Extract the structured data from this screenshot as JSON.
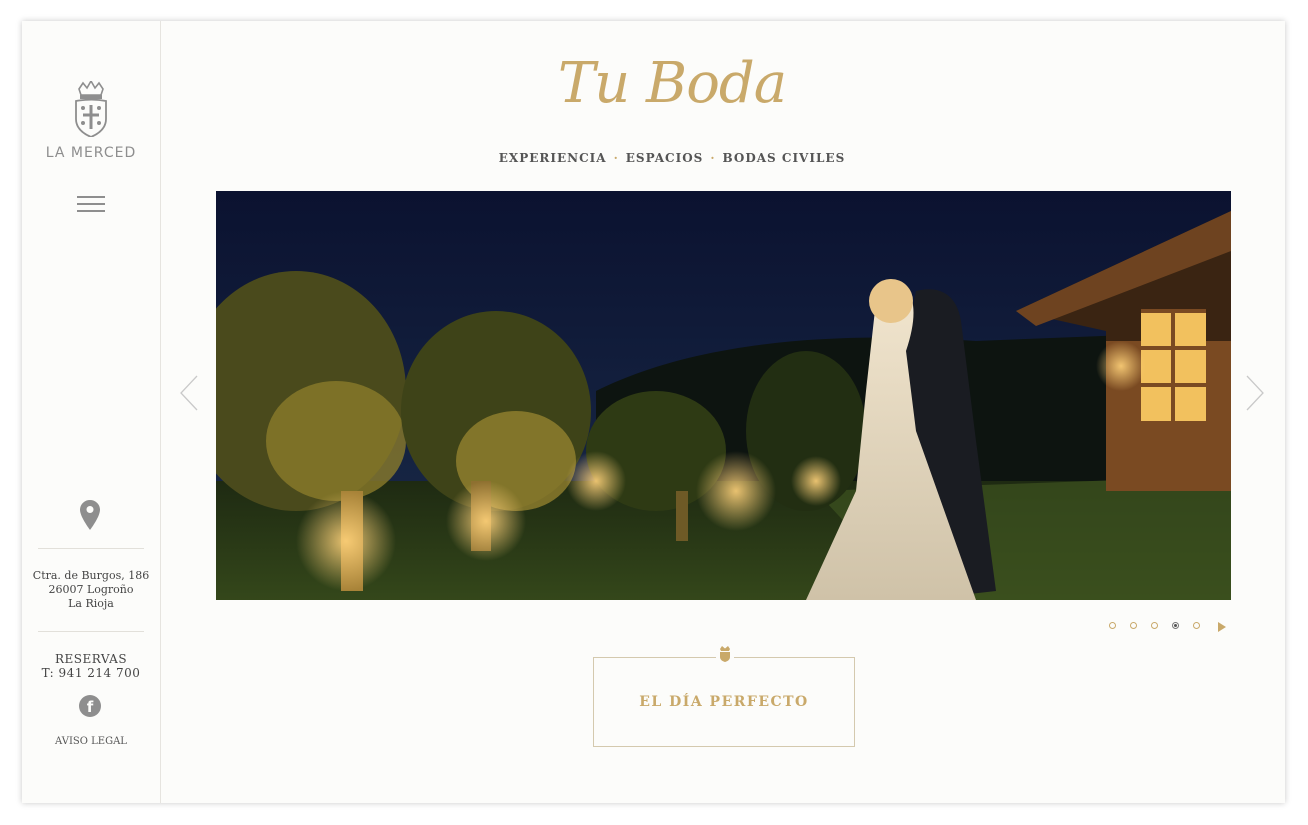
{
  "sidebar": {
    "logo_text": "LA MERCED",
    "address_line1": "Ctra. de Burgos, 186",
    "address_line2": "26007 Logroño",
    "address_line3": "La Rioja",
    "reservas_label": "RESERVAS",
    "phone": "T:  941  214  700",
    "facebook_glyph": "f",
    "aviso_legal": "AVISO LEGAL",
    "icons": [
      "crest-icon",
      "hamburger-menu-icon",
      "location-pin-icon",
      "facebook-icon"
    ]
  },
  "header": {
    "title": "Tu Boda",
    "nav": [
      {
        "label": "EXPERIENCIA"
      },
      {
        "label": "ESPACIOS"
      },
      {
        "label": "BODAS CIVILES"
      }
    ],
    "nav_separator": "·"
  },
  "slider": {
    "image_subject": "bride and groom embracing at night in illuminated olive tree garden",
    "dot_count": 5,
    "active_dot": 4
  },
  "cta": {
    "label": "EL DÍA PERFECTO"
  },
  "colors": {
    "accent_gold": "#c9a96a",
    "text_gray": "#555555",
    "icon_gray": "#8e8e8e",
    "background": "#fcfcfa"
  }
}
